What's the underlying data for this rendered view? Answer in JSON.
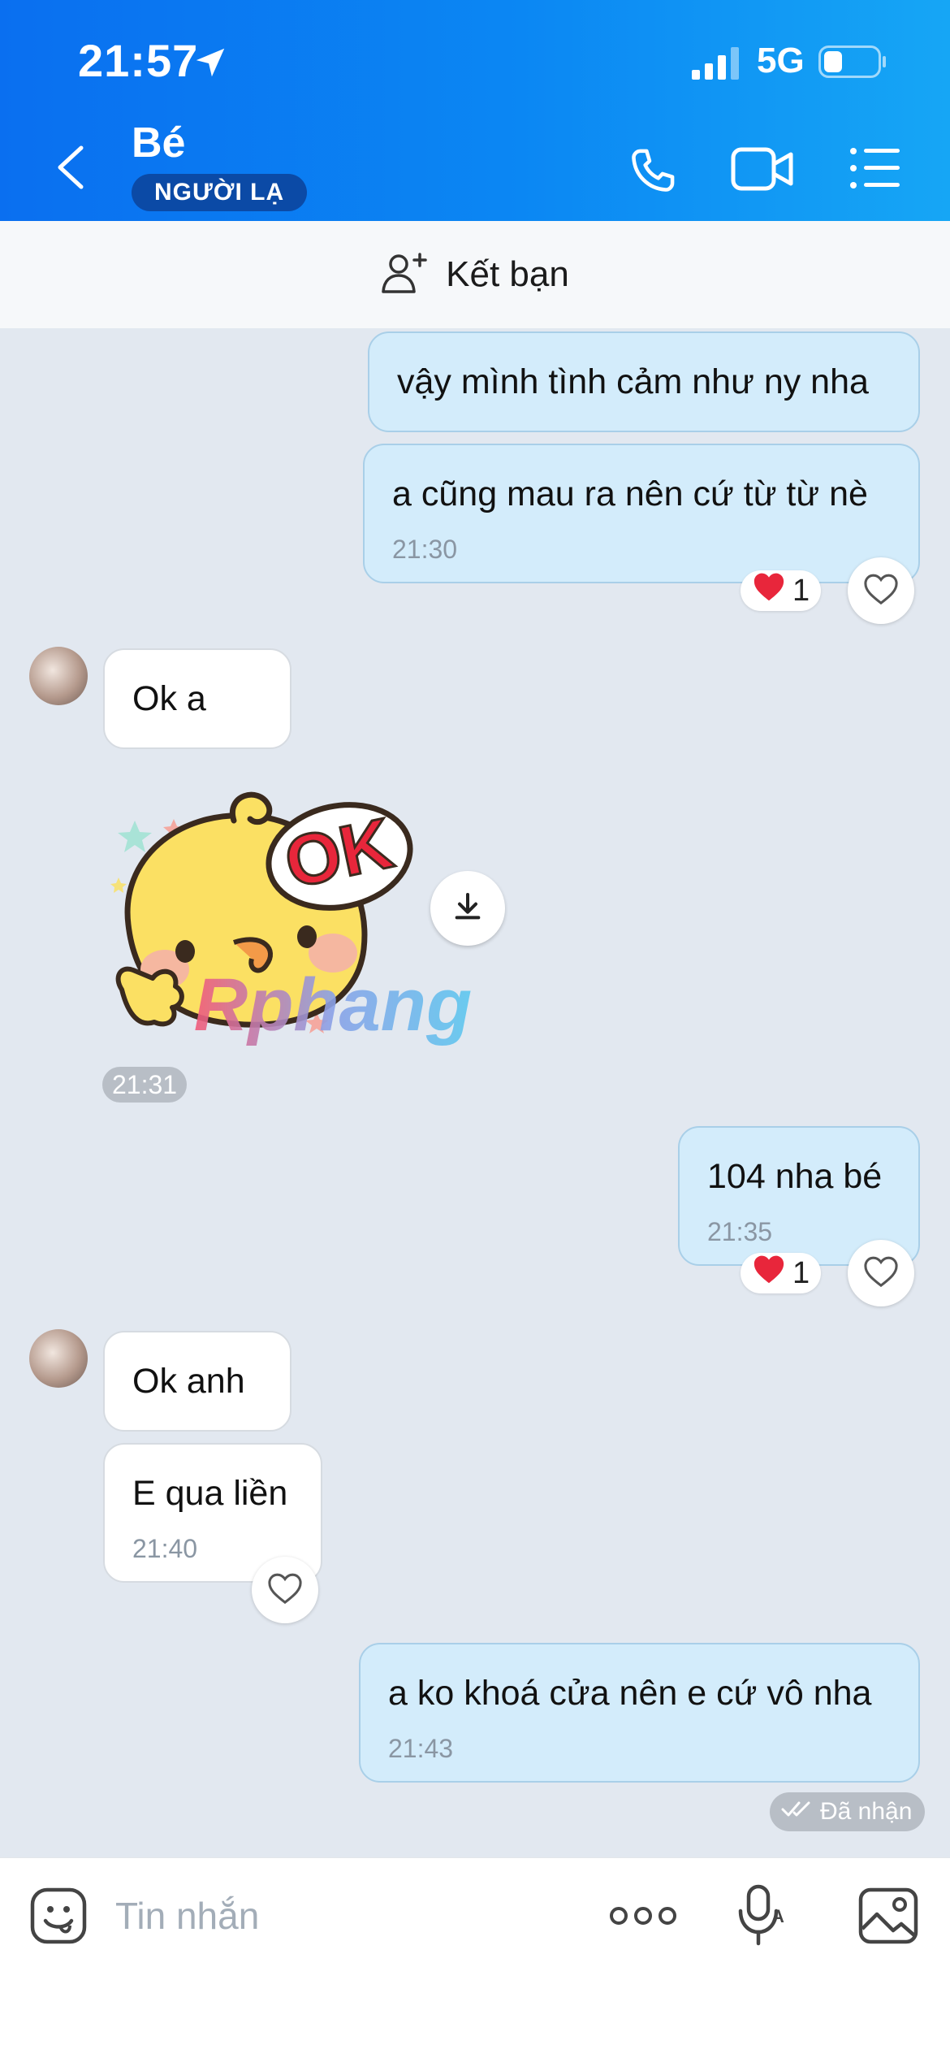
{
  "status_bar": {
    "time": "21:57",
    "network": "5G"
  },
  "header": {
    "contact_name": "Bé",
    "badge": "NGƯỜI LẠ"
  },
  "add_friend": {
    "label": "Kết bạn"
  },
  "messages": [
    {
      "dir": "out",
      "text": "vậy mình tình cảm như ny nha"
    },
    {
      "dir": "out",
      "text": "a cũng mau ra nên cứ từ từ nè",
      "time": "21:30",
      "reaction": "1"
    },
    {
      "dir": "in",
      "text": "Ok a"
    },
    {
      "dir": "in",
      "type": "sticker",
      "sticker_text": "OK",
      "watermark": "Rphang",
      "time": "21:31"
    },
    {
      "dir": "out",
      "text": "104 nha bé",
      "time": "21:35",
      "reaction": "1"
    },
    {
      "dir": "in",
      "text": "Ok anh"
    },
    {
      "dir": "in",
      "text": "E qua liền",
      "time": "21:40"
    },
    {
      "dir": "out",
      "text": "a ko khoá cửa nên e cứ vô nha",
      "time": "21:43",
      "status": "Đã nhận"
    }
  ],
  "input": {
    "placeholder": "Tin nhắn"
  },
  "icons": {
    "location": "location-arrow-icon",
    "signal": "signal-icon",
    "battery": "battery-icon",
    "back": "back-chevron-icon",
    "call": "phone-icon",
    "video": "video-camera-icon",
    "menu": "list-menu-icon",
    "add_friend": "add-user-icon",
    "heart": "heart-icon",
    "download": "download-icon",
    "emoji": "emoji-icon",
    "more": "more-dots-icon",
    "voice": "voice-mic-icon",
    "image": "image-icon",
    "check": "double-check-icon"
  },
  "colors": {
    "header_start": "#0a6ff0",
    "header_end": "#16a6f5",
    "outgoing": "#d3ecfb",
    "incoming": "#ffffff",
    "background": "#e2e8f0",
    "heart": "#e8263b"
  }
}
